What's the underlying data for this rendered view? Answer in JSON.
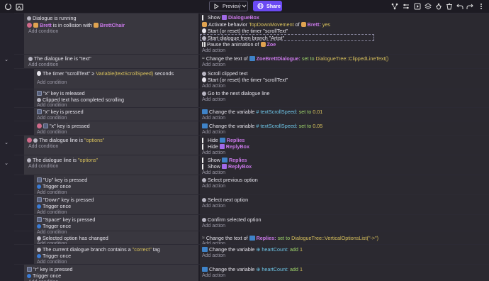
{
  "toolbar": {
    "preview_label": "Preview",
    "share_label": "Share",
    "left_icons": [
      "restart-icon",
      "gallery-icon"
    ],
    "right_icons": [
      "network-icon",
      "settings-sliders-icon",
      "play-debug-icon",
      "layers-icon",
      "bug-icon",
      "trash-icon",
      "undo-icon",
      "redo-icon",
      "more-icon"
    ]
  },
  "add_condition": "Add condition",
  "add_action": "Add action",
  "events": [
    {
      "conditions": [
        "Dialogue is running",
        "Brett is in collision with BrettChair"
      ],
      "actions": [
        "Show DialogueBox",
        "Activate behavior TopDownMovement of Brett: yes",
        "Start (or reset) the timer \"scrollText\"",
        "Start dialogue from branch \"Artist\"",
        "Pause the animation of Zoe"
      ]
    }
  ],
  "e1": {
    "c1": "Dialogue is running",
    "c2a": "Brett",
    "c2b": "is in collision with",
    "c2c": "BrettChair",
    "a1a": "Show",
    "a1b": "DialogueBox",
    "a2a": "Activate behavior",
    "a2b": "TopDownMovement",
    "a2c": "of",
    "a2d": "Brett:",
    "a2e": "yes",
    "a3": "Start (or reset) the timer \"scrollText\"",
    "a4": "Start dialogue from branch \"Artist\"",
    "a5a": "Pause the animation of",
    "a5b": "Zoe"
  },
  "e2": {
    "c1": "The dialogue line is \"text\"",
    "a1a": "Change the text of",
    "a1b": "ZoeBrettDialogue:",
    "a1c": "set to",
    "a1d": "DialogueTree::ClippedLineText()"
  },
  "e3": {
    "c1a": "The timer \"scrollText\"",
    "c1b": "≥",
    "c1c": "Variable(textScrollSpeed)",
    "c1d": "seconds",
    "a1": "Scroll clipped text",
    "a2": "Start (or reset) the timer \"scrollText\""
  },
  "e4": {
    "c1a": "\"x\"",
    "c1b": "key is released",
    "c2": "Clipped text has completed scrolling",
    "a1": "Go to the next dialogue line"
  },
  "e5": {
    "c1a": "\"x\"",
    "c1b": "key is pressed",
    "a1a": "Change the variable",
    "a1b": "textScrollSpeed:",
    "a1c": "set to",
    "a1d": "0.01"
  },
  "e6": {
    "c1a": "\"x\"",
    "c1b": "key is pressed",
    "a1a": "Change the variable",
    "a1b": "textScrollSpeed:",
    "a1c": "set to",
    "a1d": "0.05"
  },
  "e7": {
    "c1a": "The dialogue line is",
    "c1b": "\"options\"",
    "a1a": "Hide",
    "a1b": "Replies",
    "a2a": "Hide",
    "a2b": "ReplyBox"
  },
  "e8": {
    "c1a": "The dialogue line is",
    "c1b": "\"options\"",
    "a1a": "Show",
    "a1b": "Replies",
    "a2a": "Show",
    "a2b": "ReplyBox"
  },
  "e9": {
    "c1a": "\"Up\"",
    "c1b": "key is pressed",
    "c2": "Trigger once",
    "a1": "Select previous option"
  },
  "e10": {
    "c1a": "\"Down\"",
    "c1b": "key is pressed",
    "c2": "Trigger once",
    "a1": "Select next option"
  },
  "e11": {
    "c1a": "\"Space\"",
    "c1b": "key is pressed",
    "c2": "Trigger once",
    "a1": "Confirm selected option"
  },
  "e12": {
    "c1": "Selected option has changed",
    "a1a": "Change the text of",
    "a1b": "Replies:",
    "a1c": "set to",
    "a1d": "DialogueTree::VerticalOptionsList(\"->\")"
  },
  "e13": {
    "c1a": "The current dialogue branch contains a",
    "c1b": "\"correct\"",
    "c1c": "tag",
    "c2": "Trigger once",
    "a1a": "Change the variable",
    "a1b": "heartCount:",
    "a1c": "add",
    "a1d": "1"
  },
  "e14": {
    "c1a": "\"r\"",
    "c1b": "key is pressed",
    "c2": "Trigger once",
    "a1a": "Change the variable",
    "a1b": "heartCount:",
    "a1c": "add",
    "a1d": "1"
  },
  "colors": {
    "accent": "#6b4af3",
    "condition_bg": "#39373f",
    "action_bg": "#2b2930",
    "object": "#c978e8",
    "value": "#d8c15c"
  }
}
